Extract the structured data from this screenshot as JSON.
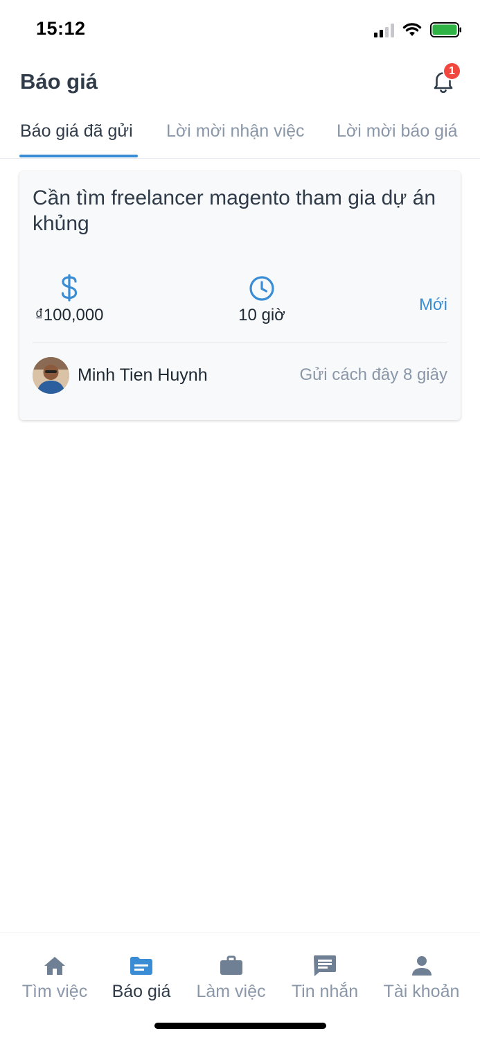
{
  "status_bar": {
    "time": "15:12",
    "signal_icon": "cellular-signal-icon",
    "wifi_icon": "wifi-icon",
    "battery_icon": "battery-icon",
    "battery_color": "#2fb344"
  },
  "header": {
    "title": "Báo giá",
    "notification_icon": "bell-icon",
    "notification_count": "1",
    "badge_color": "#f0473e"
  },
  "tabs": [
    {
      "label": "Báo giá đã gửi",
      "active": true
    },
    {
      "label": "Lời mời nhận việc",
      "active": false
    },
    {
      "label": "Lời mời báo giá",
      "active": false
    }
  ],
  "accent_color": "#3a8dd4",
  "quote_card": {
    "title": "Cần tìm freelancer magento tham gia dự án khủng",
    "price_icon": "dollar-icon",
    "price": "₫100,000",
    "duration_icon": "clock-icon",
    "duration": "10 giờ",
    "status": "Mới",
    "author_name": "Minh Tien Huynh",
    "sent_time": "Gửi cách đây 8 giây"
  },
  "bottom_nav": [
    {
      "label": "Tìm việc",
      "icon": "home-icon",
      "active": false
    },
    {
      "label": "Báo giá",
      "icon": "document-icon",
      "active": true
    },
    {
      "label": "Làm việc",
      "icon": "briefcase-icon",
      "active": false
    },
    {
      "label": "Tin nhắn",
      "icon": "chat-icon",
      "active": false
    },
    {
      "label": "Tài khoản",
      "icon": "person-icon",
      "active": false
    }
  ]
}
